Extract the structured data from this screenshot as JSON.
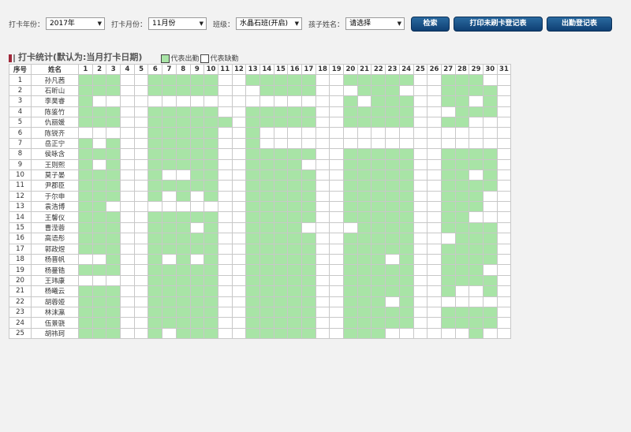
{
  "filters": {
    "year_label": "打卡年份：",
    "year_value": "2017年",
    "month_label": "打卡月份：",
    "month_value": "11月份",
    "class_label": "班级：",
    "class_value": "水晶石班(开启)",
    "child_label": "孩子姓名：",
    "child_value": "请选择"
  },
  "buttons": {
    "search": "检索",
    "print_unpunched": "打印未刷卡登记表",
    "attendance": "出勤登记表"
  },
  "section": {
    "title": "打卡统计(默认为:当月打卡日期)",
    "legend_present": "代表出勤",
    "legend_absent": "代表缺勤"
  },
  "colors": {
    "present": "#a8e4a6",
    "absent": "#ffffff",
    "accent": "#a0283a",
    "button": "#1a4f85"
  },
  "table": {
    "header_index": "序号",
    "header_name": "姓名",
    "days": [
      1,
      2,
      3,
      4,
      5,
      6,
      7,
      8,
      9,
      10,
      11,
      12,
      13,
      14,
      15,
      16,
      17,
      18,
      19,
      20,
      21,
      22,
      23,
      24,
      25,
      26,
      27,
      28,
      29,
      30,
      31
    ],
    "rows": [
      {
        "no": "1",
        "name": "孙凡茜",
        "present": [
          1,
          2,
          3,
          6,
          7,
          8,
          9,
          10,
          13,
          14,
          15,
          16,
          17,
          20,
          21,
          22,
          23,
          24,
          27,
          28,
          29
        ]
      },
      {
        "no": "2",
        "name": "石昕山",
        "present": [
          1,
          2,
          3,
          6,
          7,
          8,
          9,
          10,
          14,
          15,
          16,
          17,
          21,
          22,
          23,
          27,
          28,
          29,
          30
        ]
      },
      {
        "no": "3",
        "name": "李昊睿",
        "present": [
          1,
          20,
          22,
          23,
          24,
          27,
          28,
          30
        ]
      },
      {
        "no": "4",
        "name": "陈鉴竹",
        "present": [
          1,
          2,
          3,
          6,
          7,
          8,
          9,
          10,
          13,
          14,
          15,
          16,
          17,
          20,
          21,
          22,
          23,
          24,
          28,
          29,
          30
        ]
      },
      {
        "no": "5",
        "name": "仇丽媛",
        "present": [
          1,
          2,
          3,
          6,
          7,
          8,
          9,
          10,
          11,
          13,
          14,
          15,
          16,
          17,
          20,
          21,
          22,
          23,
          24,
          27,
          28
        ]
      },
      {
        "no": "6",
        "name": "陈锐齐",
        "present": [
          6,
          7,
          8,
          9,
          10,
          13
        ]
      },
      {
        "no": "7",
        "name": "岳正宁",
        "present": [
          1,
          3,
          6,
          7,
          8,
          9,
          10,
          13
        ]
      },
      {
        "no": "8",
        "name": "侯咏含",
        "present": [
          1,
          2,
          3,
          6,
          7,
          8,
          9,
          10,
          13,
          14,
          15,
          16,
          17,
          20,
          21,
          22,
          23,
          24,
          27,
          28,
          29,
          30
        ]
      },
      {
        "no": "9",
        "name": "王则熙",
        "present": [
          1,
          3,
          6,
          7,
          8,
          9,
          10,
          13,
          14,
          15,
          16,
          20,
          21,
          22,
          23,
          24,
          27,
          28,
          29,
          30
        ]
      },
      {
        "no": "10",
        "name": "莫子晏",
        "present": [
          1,
          2,
          3,
          6,
          9,
          10,
          13,
          14,
          15,
          16,
          17,
          20,
          21,
          22,
          23,
          24,
          27,
          28,
          30
        ]
      },
      {
        "no": "11",
        "name": "尹郡臣",
        "present": [
          1,
          2,
          3,
          6,
          7,
          8,
          9,
          10,
          13,
          14,
          15,
          16,
          17,
          20,
          21,
          22,
          23,
          24,
          27,
          28,
          29,
          30
        ]
      },
      {
        "no": "12",
        "name": "于尔申",
        "present": [
          1,
          2,
          3,
          6,
          8,
          10,
          13,
          14,
          15,
          16,
          17,
          20,
          21,
          22,
          23,
          24,
          27,
          28,
          29
        ]
      },
      {
        "no": "13",
        "name": "袁浩博",
        "present": [
          1,
          2,
          13,
          14,
          15,
          16,
          17,
          20,
          21,
          22,
          23,
          24,
          27,
          28,
          29
        ]
      },
      {
        "no": "14",
        "name": "王馨仪",
        "present": [
          1,
          2,
          3,
          6,
          7,
          8,
          9,
          10,
          13,
          14,
          15,
          16,
          17,
          20,
          21,
          22,
          23,
          24,
          27,
          28
        ]
      },
      {
        "no": "15",
        "name": "曹滢蓉",
        "present": [
          1,
          2,
          3,
          6,
          7,
          8,
          10,
          13,
          14,
          15,
          16,
          21,
          22,
          23,
          24,
          27,
          28,
          29,
          30
        ]
      },
      {
        "no": "16",
        "name": "高语彤",
        "present": [
          1,
          2,
          3,
          6,
          7,
          8,
          9,
          10,
          13,
          14,
          15,
          16,
          17,
          20,
          21,
          22,
          23,
          24,
          28,
          29,
          30
        ]
      },
      {
        "no": "17",
        "name": "郭政煜",
        "present": [
          1,
          2,
          3,
          6,
          7,
          8,
          9,
          10,
          13,
          14,
          15,
          16,
          17,
          20,
          21,
          22,
          23,
          24,
          27,
          28,
          29,
          30
        ]
      },
      {
        "no": "18",
        "name": "杨晋帆",
        "present": [
          3,
          6,
          8,
          10,
          13,
          14,
          15,
          16,
          17,
          20,
          21,
          22,
          24,
          27,
          28,
          29,
          30
        ]
      },
      {
        "no": "19",
        "name": "杨蔓锆",
        "present": [
          1,
          2,
          3,
          6,
          7,
          8,
          9,
          10,
          13,
          14,
          15,
          16,
          17,
          20,
          21,
          22,
          23,
          24,
          27,
          28,
          29
        ]
      },
      {
        "no": "20",
        "name": "王玮康",
        "present": [
          6,
          7,
          8,
          9,
          10,
          13,
          14,
          15,
          16,
          17,
          20,
          21,
          22,
          23,
          24,
          27,
          28,
          29,
          30
        ]
      },
      {
        "no": "21",
        "name": "杨曦云",
        "present": [
          1,
          2,
          3,
          6,
          7,
          8,
          9,
          10,
          13,
          14,
          15,
          16,
          17,
          20,
          21,
          22,
          23,
          24,
          27,
          30
        ]
      },
      {
        "no": "22",
        "name": "胡蓉娅",
        "present": [
          1,
          2,
          3,
          6,
          7,
          8,
          9,
          10,
          13,
          14,
          15,
          16,
          17,
          20,
          21,
          22,
          24
        ]
      },
      {
        "no": "23",
        "name": "林沫瀛",
        "present": [
          1,
          2,
          3,
          6,
          7,
          8,
          9,
          10,
          13,
          14,
          15,
          16,
          17,
          20,
          21,
          22,
          23,
          24,
          27,
          28,
          29,
          30
        ]
      },
      {
        "no": "24",
        "name": "伍景骁",
        "present": [
          1,
          2,
          3,
          6,
          7,
          8,
          9,
          10,
          13,
          14,
          15,
          16,
          17,
          20,
          21,
          22,
          23,
          24,
          27,
          28,
          29,
          30
        ]
      },
      {
        "no": "25",
        "name": "胡祎珂",
        "present": [
          1,
          2,
          3,
          6,
          8,
          9,
          10,
          13,
          14,
          15,
          16,
          17,
          20,
          21,
          22,
          29
        ]
      }
    ]
  }
}
